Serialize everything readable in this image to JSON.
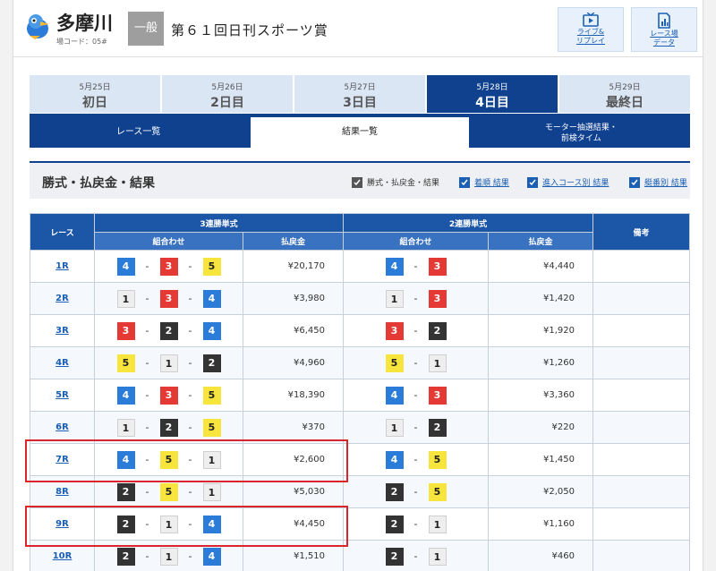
{
  "header": {
    "venue_name": "多摩川",
    "venue_code": "場コード：05#",
    "grade": "一般",
    "race_title": "第６１回日刊スポーツ賞",
    "live_label_line1": "ライブ&",
    "live_label_line2": "リプレイ",
    "data_label_line1": "レース場",
    "data_label_line2": "データ"
  },
  "day_tabs": [
    {
      "date": "5月25日",
      "label": "初日",
      "active": false
    },
    {
      "date": "5月26日",
      "label": "2日目",
      "active": false
    },
    {
      "date": "5月27日",
      "label": "3日目",
      "active": false
    },
    {
      "date": "5月28日",
      "label": "4日目",
      "active": true
    },
    {
      "date": "5月29日",
      "label": "最終日",
      "active": false
    }
  ],
  "sub_tabs": {
    "race_list": "レース一覧",
    "result_list": "結果一覧",
    "motor_line1": "モーター抽選結果・",
    "motor_line2": "前検タイム"
  },
  "section": {
    "title": "勝式・払戻金・結果",
    "filter_main": "勝式・払戻金・結果",
    "filter_rank": "着順 結果",
    "filter_course": "進入コース別 結果",
    "filter_boat": "艇番別 結果"
  },
  "table": {
    "h_race": "レース",
    "h_trifecta": "3連勝単式",
    "h_exacta": "2連勝単式",
    "h_note": "備考",
    "h_combo": "組合わせ",
    "h_payout": "払戻金",
    "rows": [
      {
        "race": "1R",
        "tri": [
          "4",
          "3",
          "5"
        ],
        "tri_pay": "¥20,170",
        "ex": [
          "4",
          "3"
        ],
        "ex_pay": "¥4,440",
        "note": ""
      },
      {
        "race": "2R",
        "tri": [
          "1",
          "3",
          "4"
        ],
        "tri_pay": "¥3,980",
        "ex": [
          "1",
          "3"
        ],
        "ex_pay": "¥1,420",
        "note": ""
      },
      {
        "race": "3R",
        "tri": [
          "3",
          "2",
          "4"
        ],
        "tri_pay": "¥6,450",
        "ex": [
          "3",
          "2"
        ],
        "ex_pay": "¥1,920",
        "note": ""
      },
      {
        "race": "4R",
        "tri": [
          "5",
          "1",
          "2"
        ],
        "tri_pay": "¥4,960",
        "ex": [
          "5",
          "1"
        ],
        "ex_pay": "¥1,260",
        "note": ""
      },
      {
        "race": "5R",
        "tri": [
          "4",
          "3",
          "5"
        ],
        "tri_pay": "¥18,390",
        "ex": [
          "4",
          "3"
        ],
        "ex_pay": "¥3,360",
        "note": ""
      },
      {
        "race": "6R",
        "tri": [
          "1",
          "2",
          "5"
        ],
        "tri_pay": "¥370",
        "ex": [
          "1",
          "2"
        ],
        "ex_pay": "¥220",
        "note": ""
      },
      {
        "race": "7R",
        "tri": [
          "4",
          "5",
          "1"
        ],
        "tri_pay": "¥2,600",
        "ex": [
          "4",
          "5"
        ],
        "ex_pay": "¥1,450",
        "note": ""
      },
      {
        "race": "8R",
        "tri": [
          "2",
          "5",
          "1"
        ],
        "tri_pay": "¥5,030",
        "ex": [
          "2",
          "5"
        ],
        "ex_pay": "¥2,050",
        "note": ""
      },
      {
        "race": "9R",
        "tri": [
          "2",
          "1",
          "4"
        ],
        "tri_pay": "¥4,450",
        "ex": [
          "2",
          "1"
        ],
        "ex_pay": "¥1,160",
        "note": ""
      },
      {
        "race": "10R",
        "tri": [
          "2",
          "1",
          "4"
        ],
        "tri_pay": "¥1,510",
        "ex": [
          "2",
          "1"
        ],
        "ex_pay": "¥460",
        "note": ""
      }
    ]
  },
  "colors": {
    "navy": "#10418f",
    "header_blue": "#1c56a6",
    "highlight_red": "#d9262c",
    "boat_1": "#eeeeee",
    "boat_2": "#333333",
    "boat_3": "#e53935",
    "boat_4": "#2b7bd8",
    "boat_5": "#f7e43c",
    "boat_6": "#2e9b3d"
  },
  "icons": {
    "logo": "bird-mascot-icon",
    "live": "tv-icon",
    "data": "bar-chart-doc-icon",
    "check": "check-icon"
  }
}
